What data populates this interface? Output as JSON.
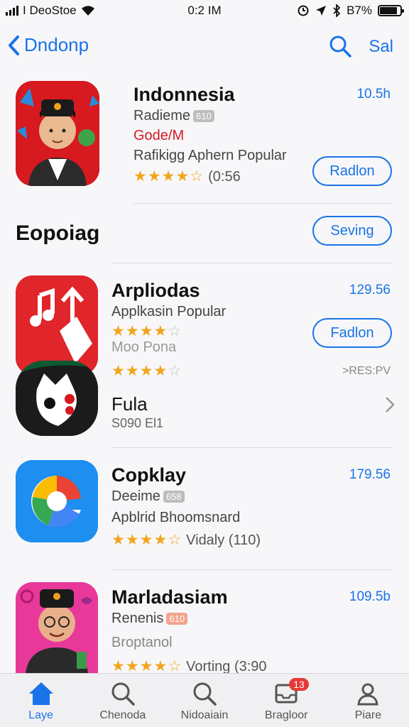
{
  "status_bar": {
    "carrier": "I DeoStoe",
    "time": "0:2 IM",
    "battery": "B7%",
    "battery_level": 0.87
  },
  "nav": {
    "back_label": "Dndonp",
    "action_label": "Sal"
  },
  "section": {
    "title": "Eopoiag",
    "button": "Seving"
  },
  "apps": [
    {
      "name": "Indonnesia",
      "price": "10.5h",
      "line1": "Radieme",
      "badge1": "610",
      "line2": "Gode/M",
      "line3": "Rafikigg Aphern Popular",
      "rating": 4.5,
      "rating_text": "(0:56",
      "button": "Radlon"
    },
    {
      "name": "Arpliodas",
      "price": "129.56",
      "line1": "Applkasin Popular",
      "rating": 4,
      "line2": "Moo Pona",
      "rating2": 4,
      "tag": ">RES:PV",
      "button": "Fadlon"
    },
    {
      "name": "Fula",
      "sub": "S090 El1"
    },
    {
      "name": "Copklay",
      "price": "179.56",
      "line1": "Deeime",
      "badge1": "658",
      "line2": "Apblrid Bhoomsnard",
      "rating": 4,
      "rating_text": "Vidaly (110)"
    },
    {
      "name": "Marladasiam",
      "price": "109.5b",
      "line1": "Renenis",
      "badge1": "610",
      "line2": "Broptanol",
      "rating": 4.5,
      "rating_text": "Vorting (3:90"
    }
  ],
  "tabs": [
    {
      "label": "Laye",
      "icon": "home-icon",
      "active": true
    },
    {
      "label": "Chenoda",
      "icon": "search-icon"
    },
    {
      "label": "Nidoaiain",
      "icon": "search-icon"
    },
    {
      "label": "Bragloor",
      "icon": "inbox-icon",
      "badge": "13"
    },
    {
      "label": "Piare",
      "icon": "person-icon"
    }
  ],
  "colors": {
    "accent": "#1a73e8",
    "star": "#f2a51a",
    "badge_red": "#e53935"
  }
}
